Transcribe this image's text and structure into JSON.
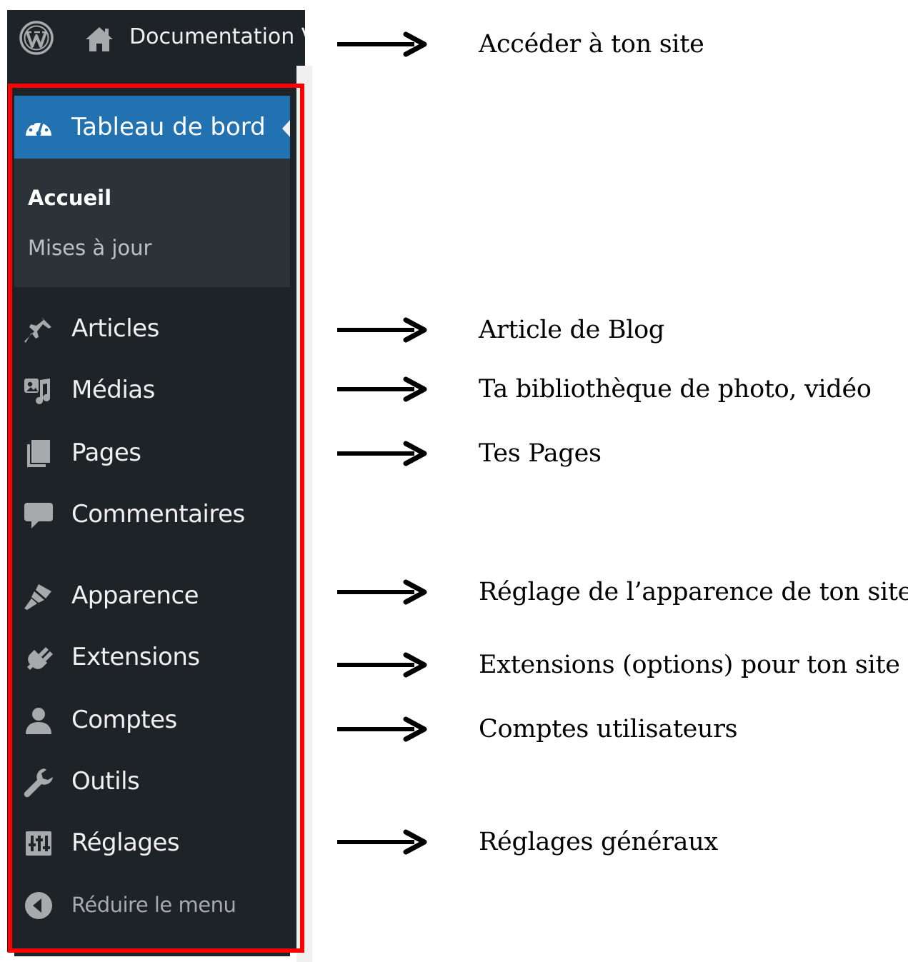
{
  "admin_bar": {
    "logo_icon": "wordpress-logo-icon",
    "home_icon": "home-icon",
    "site_name": "Documentation V"
  },
  "sidebar": {
    "active_item": {
      "label": "Tableau de bord",
      "icon": "dashboard-gauge-icon"
    },
    "submenu": [
      {
        "label": "Accueil",
        "current": true
      },
      {
        "label": "Mises à jour",
        "current": false
      }
    ],
    "items": [
      {
        "label": "Articles",
        "icon": "pushpin-icon"
      },
      {
        "label": "Médias",
        "icon": "media-icon"
      },
      {
        "label": "Pages",
        "icon": "pages-icon"
      },
      {
        "label": "Commentaires",
        "icon": "comment-icon"
      },
      {
        "label": "Apparence",
        "icon": "paintbrush-icon"
      },
      {
        "label": "Extensions",
        "icon": "plugin-icon"
      },
      {
        "label": "Comptes",
        "icon": "user-icon"
      },
      {
        "label": "Outils",
        "icon": "wrench-icon"
      },
      {
        "label": "Réglages",
        "icon": "settings-sliders-icon"
      }
    ],
    "collapse": {
      "label": "Réduire le menu",
      "icon": "collapse-arrow-icon"
    }
  },
  "annotations": [
    "Accéder à ton site",
    "Article de Blog",
    "Ta bibliothèque de photo, vidéo",
    "Tes Pages",
    "Réglage de l’apparence de ton site",
    "Extensions (options) pour ton site",
    "Comptes utilisateurs",
    "Réglages généraux"
  ],
  "colors": {
    "sidebar_bg": "#1d2327",
    "submenu_bg": "#2c3338",
    "active_blue": "#2271b1",
    "highlight_frame": "#ff0000"
  }
}
